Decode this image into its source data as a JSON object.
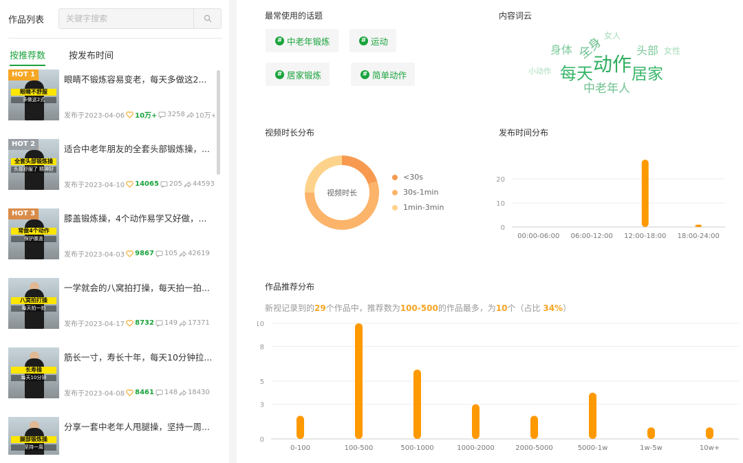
{
  "left": {
    "title": "作品列表",
    "search_placeholder": "关键字搜索",
    "tabs": [
      {
        "label": "按推荐数",
        "active": true
      },
      {
        "label": "按发布时间",
        "active": false
      }
    ],
    "items": [
      {
        "hot": "HOT 1",
        "hot_color": "#f5a623",
        "cap": "眼睛不舒服",
        "cap2": "多做这2式",
        "title": "眼睛不锻炼容易变老，每天多做这2...",
        "date": "发布于2023-04-06",
        "likes": "10万+",
        "comments": "3258",
        "shares": "10万+"
      },
      {
        "hot": "HOT 2",
        "hot_color": "#9aa0a6",
        "cap": "全套头部锻炼操",
        "cap2": "头部舒服了 精神好",
        "title": "适合中老年朋友的全套头部锻炼操，...",
        "date": "发布于2023-04-10",
        "likes": "14065",
        "comments": "205",
        "shares": "44593"
      },
      {
        "hot": "HOT 3",
        "hot_color": "#d98c4a",
        "cap": "常做4个动作",
        "cap2": "保护膝盖",
        "title": "膝盖锻炼操，4个动作易学又好做，...",
        "date": "发布于2023-04-03",
        "likes": "9867",
        "comments": "105",
        "shares": "42619"
      },
      {
        "hot": "",
        "hot_color": "",
        "cap": "八窝拍打操",
        "cap2": "每天拍一拍",
        "title": "一学就会的八窝拍打操，每天拍一拍...",
        "date": "发布于2023-04-17",
        "likes": "8732",
        "comments": "149",
        "shares": "17371"
      },
      {
        "hot": "",
        "hot_color": "",
        "cap": "长寿操",
        "cap2": "每天10分钟",
        "title": "筋长一寸，寿长十年，每天10分钟拉...",
        "date": "发布于2023-04-08",
        "likes": "8461",
        "comments": "148",
        "shares": "18430"
      },
      {
        "hot": "",
        "hot_color": "",
        "cap": "腿部锻炼操",
        "cap2": "坚持一周",
        "title": "分享一套中老年人甩腿操，坚持一周...",
        "date": "",
        "likes": "",
        "comments": "",
        "shares": ""
      }
    ]
  },
  "topics": {
    "title": "最常使用的话题",
    "items": [
      "中老年锻炼",
      "运动",
      "居家锻炼",
      "简单动作"
    ],
    "accent": "#1aa33c"
  },
  "cloud": {
    "title": "内容词云",
    "words": [
      "身体",
      "全身",
      "女人",
      "头部",
      "女性",
      "小动作",
      "每天",
      "动作",
      "居家",
      "中老年人"
    ]
  },
  "duration": {
    "title": "视频时长分布",
    "center_label": "视频时长",
    "legend": [
      {
        "label": "<30s",
        "color": "#f79a4f"
      },
      {
        "label": "30s-1min",
        "color": "#fbb46a"
      },
      {
        "label": "1min-3min",
        "color": "#fdd38c"
      }
    ]
  },
  "summary": {
    "title": "作品推荐分布",
    "p1": "新视记录到的",
    "count": "29",
    "p2": "个作品中，推荐数为",
    "range": "100-500",
    "p3": "的作品最多，为",
    "num": "10",
    "p4": "个（占比 ",
    "pct": "34%",
    "p5": "）"
  },
  "chart_data": [
    {
      "type": "pie",
      "title": "视频时长分布",
      "labels": [
        "<30s",
        "30s-1min",
        "1min-3min"
      ],
      "values": [
        20,
        55,
        25
      ],
      "center_label": "视频时长"
    },
    {
      "type": "bar",
      "title": "发布时间分布",
      "categories": [
        "00:00-06:00",
        "06:00-12:00",
        "12:00-18:00",
        "18:00-24:00"
      ],
      "values": [
        0,
        0,
        28,
        1
      ],
      "yticks": [
        0,
        10,
        20
      ],
      "ylim": [
        0,
        30
      ],
      "color": "#ff9900"
    },
    {
      "type": "bar",
      "title": "作品推荐分布",
      "categories": [
        "0-100",
        "100-500",
        "500-1000",
        "1000-2000",
        "2000-5000",
        "5000-1w",
        "1w-5w",
        "10w+"
      ],
      "values": [
        2,
        10,
        6,
        3,
        2,
        4,
        1,
        1
      ],
      "yticks": [
        0,
        3,
        5,
        8,
        10
      ],
      "ylim": [
        0,
        10
      ],
      "color": "#ff9900"
    }
  ]
}
